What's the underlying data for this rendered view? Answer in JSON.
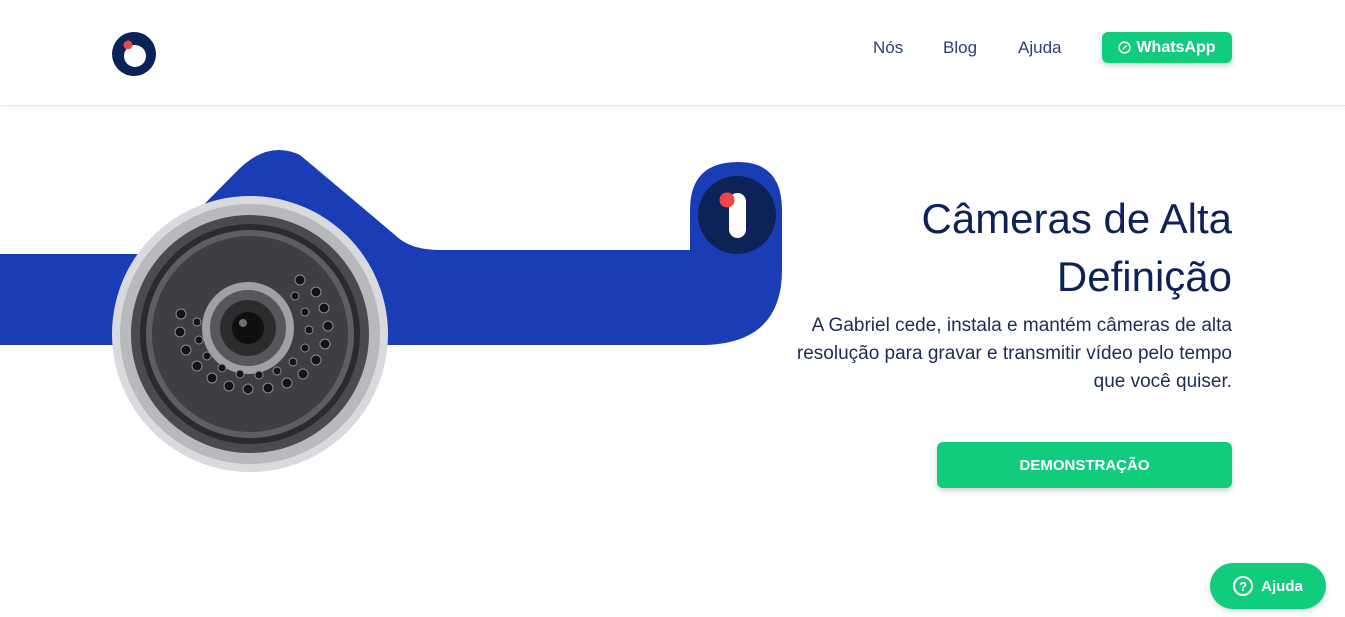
{
  "header": {
    "logo_icon": "brand-logo-icon",
    "nav": [
      {
        "label": "Nós"
      },
      {
        "label": "Blog"
      },
      {
        "label": "Ajuda"
      }
    ],
    "whatsapp": {
      "label": "WhatsApp",
      "icon": "whatsapp-icon"
    }
  },
  "hero": {
    "title_line1": "Câmeras de Alta",
    "title_line2": "Definição",
    "description": "A Gabriel cede, instala e mantém câmeras de alta resolução para gravar e transmitir vídeo pelo tempo que você quiser.",
    "cta_label": "DEMONSTRAÇÃO"
  },
  "help_fab": {
    "label": "Ajuda",
    "icon": "question-icon",
    "icon_glyph": "?"
  },
  "colors": {
    "brand_blue": "#1a3db5",
    "navy": "#0d2357",
    "green": "#12cc7e",
    "accent_red": "#f04545"
  }
}
